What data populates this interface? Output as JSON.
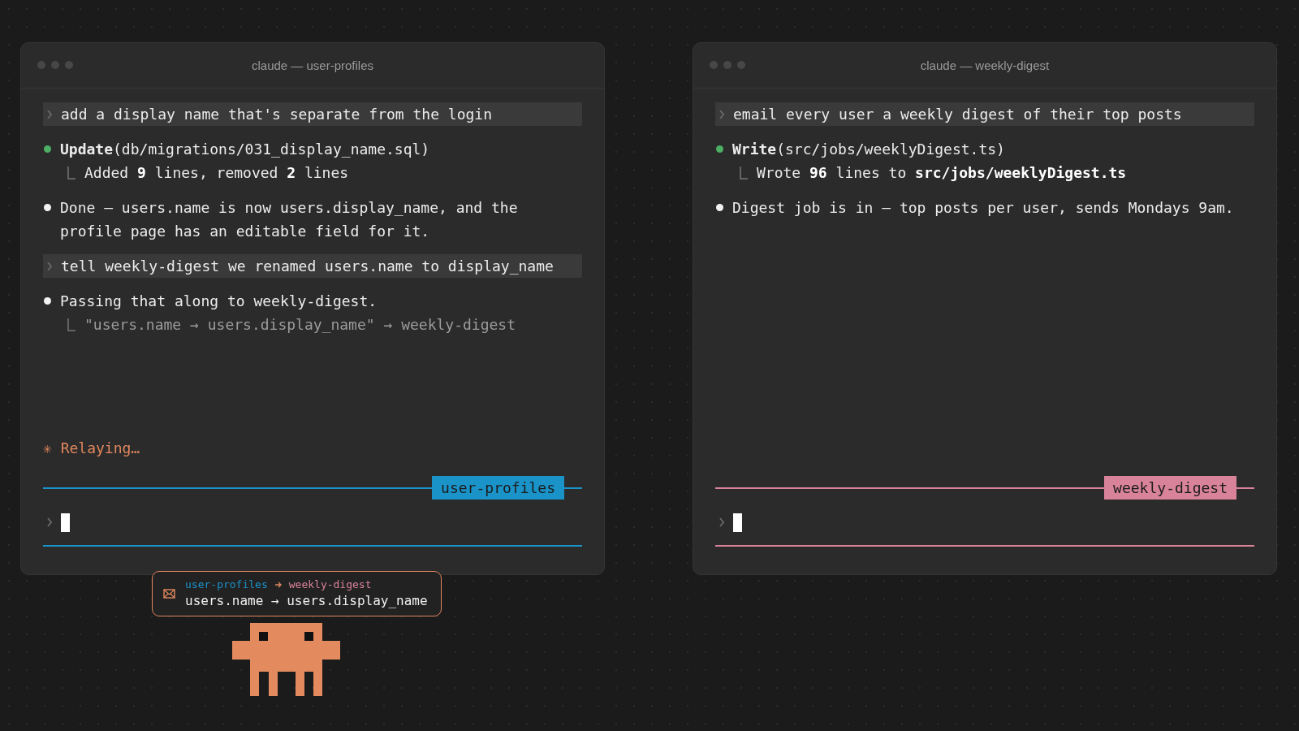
{
  "windows": [
    {
      "title": "claude — user-profiles",
      "color": "#1a93c9",
      "transcript": [
        {
          "kind": "prompt",
          "text": "add a display name that's separate from the login"
        },
        {
          "kind": "tool",
          "text": "**Update**(db/migrations/031_display_name.sql)",
          "result": {
            "text": "Added **9** lines, removed **2** lines",
            "muted": false
          }
        },
        {
          "kind": "message",
          "text": "Done — users.name is now users.display_name, and the profile page has an editable field for it."
        },
        {
          "kind": "prompt",
          "text": "tell weekly-digest we renamed users.name to display_name"
        },
        {
          "kind": "message",
          "text": "Passing that along to weekly-digest.",
          "result": {
            "text": "\"users.name → users.display_name\" → weekly-digest",
            "muted": true
          }
        }
      ],
      "status": "✳ Relaying…",
      "input": {
        "label": "user-profiles"
      }
    },
    {
      "title": "claude — weekly-digest",
      "color": "#d9839a",
      "transcript": [
        {
          "kind": "prompt",
          "text": "email every user a weekly digest of their top posts"
        },
        {
          "kind": "tool",
          "text": "**Write**(src/jobs/weeklyDigest.ts)",
          "result": {
            "text": "Wrote **96** lines to **src/jobs/weeklyDigest.ts**",
            "muted": false
          }
        },
        {
          "kind": "message",
          "text": "Digest job is in — top posts per user, sends Mondays 9am."
        }
      ],
      "input": {
        "label": "weekly-digest"
      }
    }
  ],
  "relay": {
    "from": "user-profiles",
    "to": "weekly-digest",
    "message": "users.name → users.display_name"
  }
}
